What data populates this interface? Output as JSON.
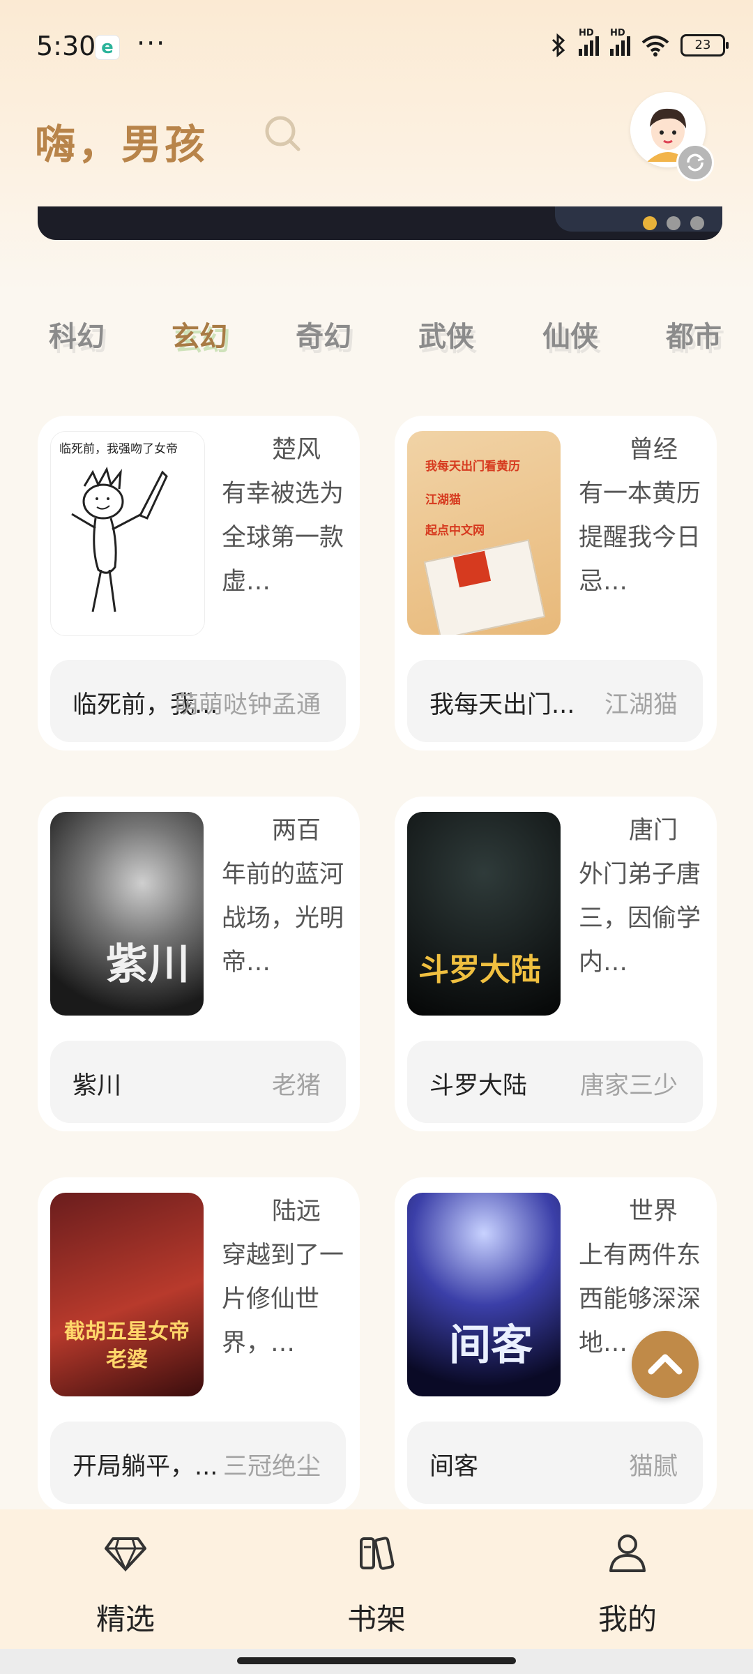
{
  "status_bar": {
    "time": "5:30",
    "more": "···",
    "battery": "23",
    "network": "HD"
  },
  "header": {
    "greeting": "嗨，男孩"
  },
  "categories": [
    "科幻",
    "玄幻",
    "奇幻",
    "武侠",
    "仙侠",
    "都市"
  ],
  "active_category": "玄幻",
  "books": [
    {
      "title": "临死前，我...",
      "author": "萌萌哒钟孟通",
      "intro": "楚风有幸被选为全球第一款虚…",
      "cover_text": "临死前，我强吻了女帝"
    },
    {
      "title": "我每天出门...",
      "author": "江湖猫",
      "intro": "曾经有一本黄历提醒我今日忌…",
      "cover_text": "我每天出门看黄历",
      "cover_sub1": "江湖猫",
      "cover_sub2": "起点中文网"
    },
    {
      "title": "紫川",
      "author": "老猪",
      "intro": "两百年前的蓝河战场，光明帝…",
      "cover_text": "紫川"
    },
    {
      "title": "斗罗大陆",
      "author": "唐家三少",
      "intro": "唐门外门弟子唐三，因偷学内…",
      "cover_text": "斗罗大陆"
    },
    {
      "title": "开局躺平，...",
      "author": "三冠绝尘",
      "intro": "陆远穿越到了一片修仙世界，…",
      "cover_text": "截胡五星女帝老婆"
    },
    {
      "title": "间客",
      "author": "猫腻",
      "intro": "世界上有两件东西能够深深地…",
      "cover_text": "间客"
    }
  ],
  "bottom_nav": [
    {
      "label": "精选",
      "icon": "diamond-icon"
    },
    {
      "label": "书架",
      "icon": "bookshelf-icon"
    },
    {
      "label": "我的",
      "icon": "person-icon"
    }
  ],
  "colors": {
    "accent": "#c08a48",
    "background": "#fbf7f0",
    "nav_background": "#fdf1e0"
  }
}
